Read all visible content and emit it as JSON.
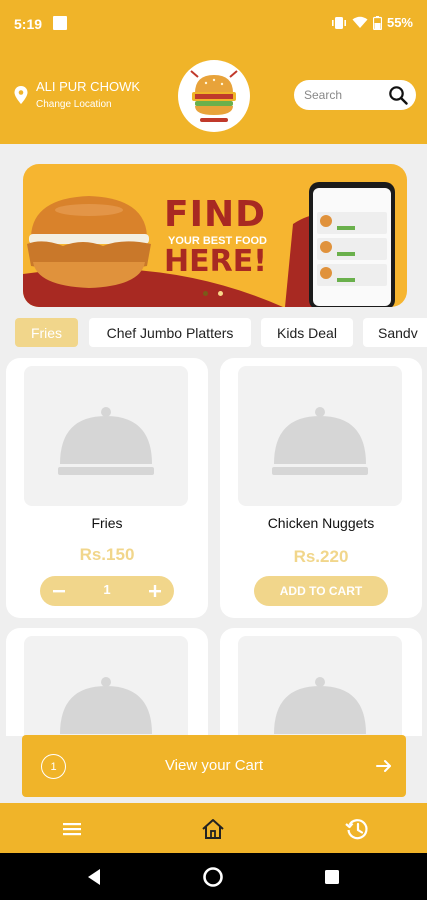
{
  "status_bar": {
    "time": "5:19",
    "battery": "55%"
  },
  "header": {
    "location_name": "ALI PUR CHOWK",
    "change_location": "Change Location",
    "search_placeholder": "Search"
  },
  "banner": {
    "headline_top": "FIND",
    "subline": "YOUR BEST FOOD",
    "headline_bottom": "HERE!",
    "active_slide": 0,
    "slide_count": 2
  },
  "categories": [
    {
      "label": "Fries",
      "active": true
    },
    {
      "label": "Chef Jumbo Platters",
      "active": false
    },
    {
      "label": "Kids Deal",
      "active": false
    },
    {
      "label": "Sandv",
      "active": false
    }
  ],
  "products": [
    {
      "name": "Fries",
      "price": "Rs.150",
      "in_cart": true,
      "quantity": "1"
    },
    {
      "name": "Chicken Nuggets",
      "price": "Rs.220",
      "in_cart": false,
      "action_label": "ADD TO CART"
    }
  ],
  "cart": {
    "count": "1",
    "label": "View your Cart"
  },
  "colors": {
    "primary": "#f0b429",
    "pale_accent": "#f1d68b",
    "banner_red": "#a82922"
  },
  "icons": [
    "location-pin-icon",
    "search-icon",
    "minus-icon",
    "plus-icon",
    "arrow-right-icon",
    "menu-icon",
    "home-icon",
    "history-icon",
    "back-icon",
    "home-circle-icon",
    "recents-icon"
  ]
}
